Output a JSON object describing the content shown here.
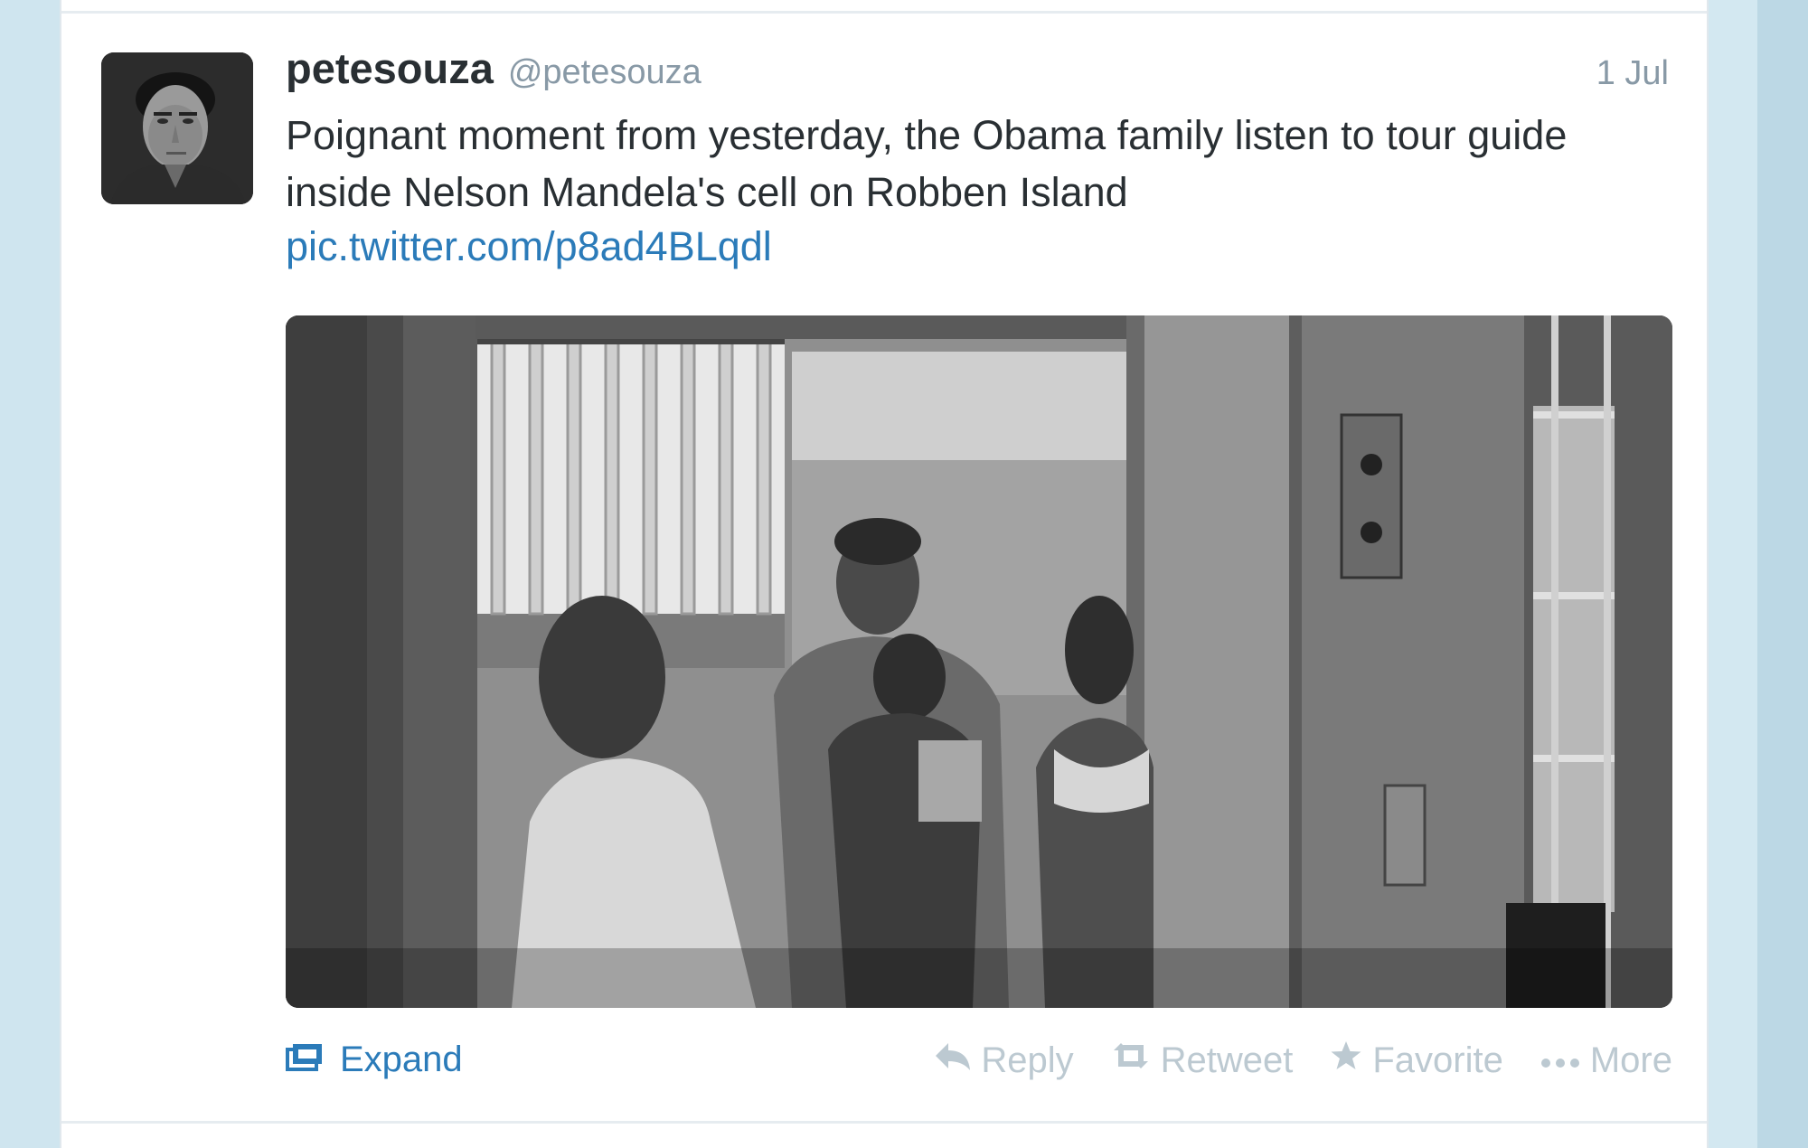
{
  "tweet": {
    "fullname": "petesouza",
    "username": "@petesouza",
    "timestamp": "1 Jul",
    "text": "Poignant moment from yesterday, the Obama family listen to tour guide inside Nelson Mandela's cell on Robben Island",
    "link": "pic.twitter.com/p8ad4BLqdl"
  },
  "actions": {
    "expand": "Expand",
    "reply": "Reply",
    "retweet": "Retweet",
    "favorite": "Favorite",
    "more": "More"
  },
  "icons": {
    "expand": "expand-photo-icon",
    "reply": "reply-arrow-icon",
    "retweet": "retweet-icon",
    "favorite": "star-icon",
    "more": "ellipsis-icon"
  },
  "colors": {
    "page_background": "#c9e1ec",
    "card_background": "#ffffff",
    "text": "#292f33",
    "secondary_text": "#8899a6",
    "link": "#2b7bb9",
    "muted_action": "#bcc9d1"
  }
}
